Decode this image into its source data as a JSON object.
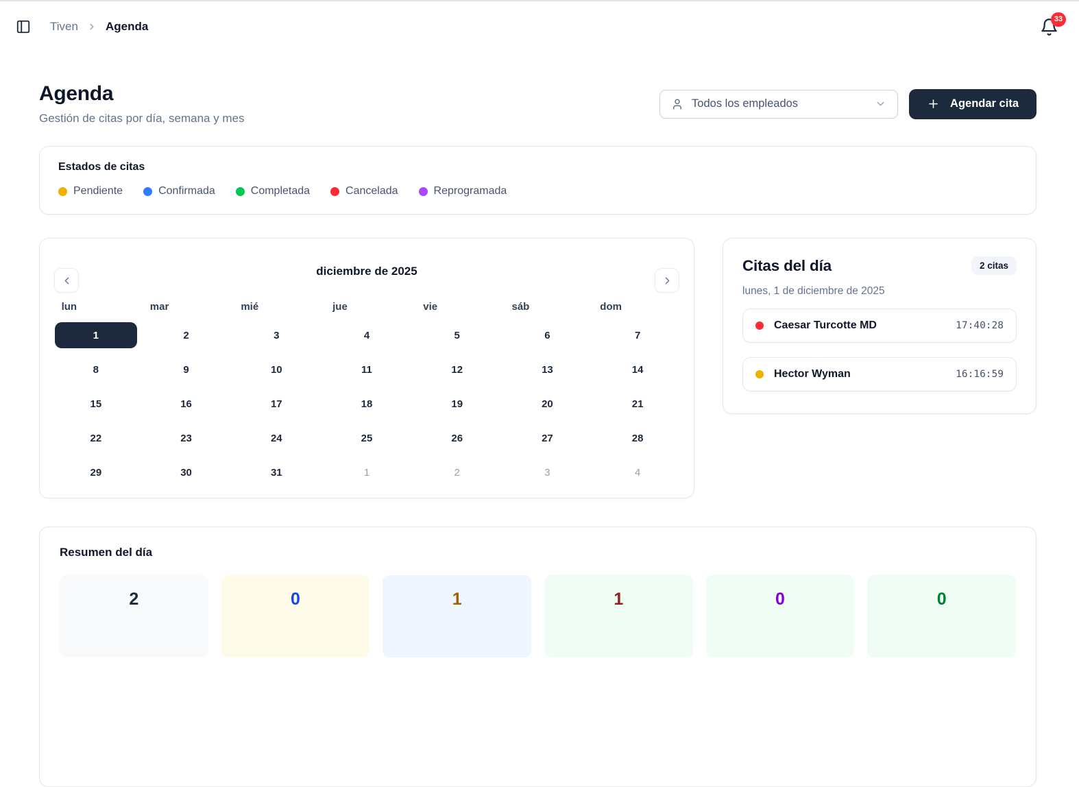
{
  "topbar": {
    "breadcrumb": {
      "app": "Tiven",
      "page": "Agenda"
    },
    "notifications_count": "33"
  },
  "header": {
    "title": "Agenda",
    "subtitle": "Gestión de citas por día, semana y mes",
    "employee_filter_value": "Todos los empleados",
    "schedule_button_label": "Agendar cita"
  },
  "status_legend": {
    "title": "Estados de citas",
    "items": [
      {
        "label": "Pendiente",
        "color": "#f0b100"
      },
      {
        "label": "Confirmada",
        "color": "#2b7fff"
      },
      {
        "label": "Completada",
        "color": "#00c951"
      },
      {
        "label": "Cancelada",
        "color": "#fb2c36"
      },
      {
        "label": "Reprogramada",
        "color": "#ad46ff"
      }
    ]
  },
  "calendar": {
    "month_title": "diciembre de 2025",
    "weekdays": [
      {
        "label": "lun"
      },
      {
        "label": "mar"
      },
      {
        "label": "mié"
      },
      {
        "label": "jue"
      },
      {
        "label": "vie"
      },
      {
        "label": "sáb"
      },
      {
        "label": "dom"
      }
    ],
    "days": [
      {
        "day": "1",
        "selected": true
      },
      {
        "day": "2"
      },
      {
        "day": "3"
      },
      {
        "day": "4"
      },
      {
        "day": "5"
      },
      {
        "day": "6"
      },
      {
        "day": "7"
      },
      {
        "day": "8"
      },
      {
        "day": "9"
      },
      {
        "day": "10"
      },
      {
        "day": "11"
      },
      {
        "day": "12"
      },
      {
        "day": "13"
      },
      {
        "day": "14"
      },
      {
        "day": "15"
      },
      {
        "day": "16"
      },
      {
        "day": "17"
      },
      {
        "day": "18"
      },
      {
        "day": "19"
      },
      {
        "day": "20"
      },
      {
        "day": "21"
      },
      {
        "day": "22"
      },
      {
        "day": "23"
      },
      {
        "day": "24"
      },
      {
        "day": "25"
      },
      {
        "day": "26"
      },
      {
        "day": "27"
      },
      {
        "day": "28"
      },
      {
        "day": "29"
      },
      {
        "day": "30"
      },
      {
        "day": "31"
      },
      {
        "day": "1",
        "muted": true
      },
      {
        "day": "2",
        "muted": true
      },
      {
        "day": "3",
        "muted": true
      },
      {
        "day": "4",
        "muted": true
      }
    ]
  },
  "day_appointments": {
    "title": "Citas del día",
    "count_badge": "2 citas",
    "date": "lunes, 1 de diciembre de 2025",
    "items": [
      {
        "name": "Caesar Turcotte MD",
        "time": "17:40:28",
        "status_color": "#fb2c36"
      },
      {
        "name": "Hector Wyman",
        "time": "16:16:59",
        "status_color": "#f0b100"
      }
    ]
  },
  "summary": {
    "title": "Resumen del día",
    "stats": [
      {
        "value": "2",
        "bg": "#f8fafc",
        "color": "#1d293d"
      },
      {
        "value": "0",
        "bg": "#fefce8",
        "color": "#1447e6"
      },
      {
        "value": "1",
        "bg": "#eff6ff",
        "color": "#a65f00"
      },
      {
        "value": "1",
        "bg": "#f0fdf4",
        "color": "#9b1c1c"
      },
      {
        "value": "0",
        "bg": "#f0fdf4",
        "color": "#8200db"
      },
      {
        "value": "0",
        "bg": "#f0fdf4",
        "color": "#008236"
      }
    ]
  }
}
